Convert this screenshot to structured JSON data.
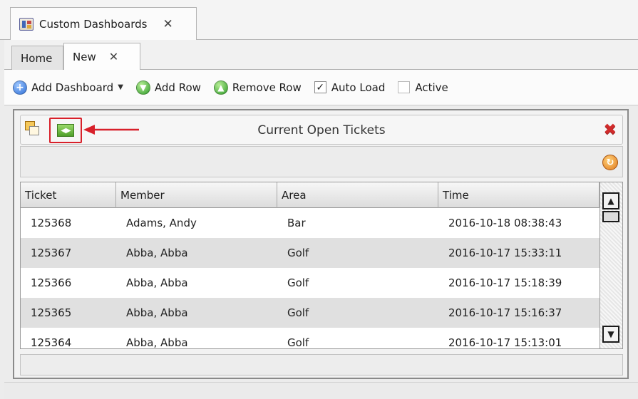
{
  "window_tab": {
    "title": "Custom Dashboards",
    "close_glyph": "✕",
    "icon": "dashboard-app-icon"
  },
  "tabs": [
    {
      "label": "Home"
    },
    {
      "label": "New",
      "close_glyph": "✕"
    }
  ],
  "toolbar": {
    "add_dashboard": "Add Dashboard",
    "add_row": "Add Row",
    "remove_row": "Remove Row",
    "auto_load": {
      "label": "Auto Load",
      "checked": true
    },
    "active": {
      "label": "Active",
      "checked": false
    }
  },
  "panel": {
    "title": "Current Open Tickets",
    "highlight_color": "#d8202a",
    "grid": {
      "columns": [
        "Ticket",
        "Member",
        "Area",
        "Time"
      ],
      "rows": [
        [
          "125368",
          "Adams, Andy",
          "Bar",
          "2016-10-18 08:38:43"
        ],
        [
          "125367",
          "Abba, Abba",
          "Golf",
          "2016-10-17 15:33:11"
        ],
        [
          "125366",
          "Abba, Abba",
          "Golf",
          "2016-10-17 15:18:39"
        ],
        [
          "125365",
          "Abba, Abba",
          "Golf",
          "2016-10-17 15:16:37"
        ],
        [
          "125364",
          "Abba, Abba",
          "Golf",
          "2016-10-17 15:13:01"
        ]
      ]
    }
  }
}
